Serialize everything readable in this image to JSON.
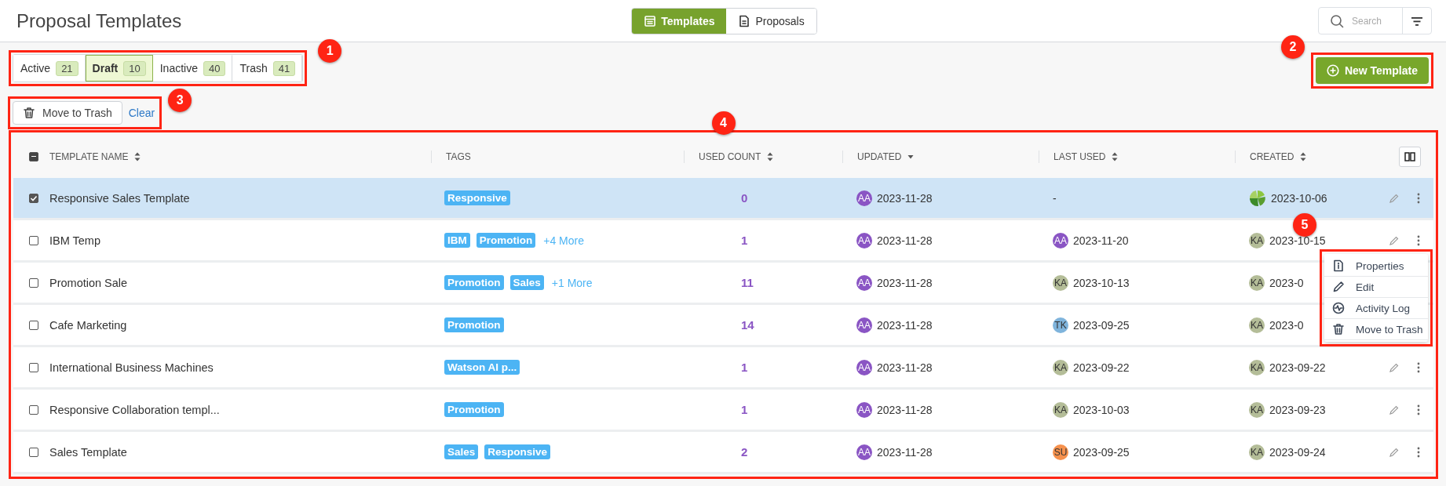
{
  "header": {
    "title": "Proposal Templates",
    "view_toggle": [
      {
        "kind": "templates",
        "label": "Templates",
        "selected": true
      },
      {
        "kind": "proposals",
        "label": "Proposals",
        "selected": false
      }
    ],
    "search": {
      "placeholder": "Search"
    }
  },
  "status_tabs": {
    "annotation": "1",
    "tabs": [
      {
        "label": "Active",
        "count": "21",
        "selected": false
      },
      {
        "label": "Draft",
        "count": "10",
        "selected": true
      },
      {
        "label": "Inactive",
        "count": "40",
        "selected": false
      },
      {
        "label": "Trash",
        "count": "41",
        "selected": false
      }
    ]
  },
  "new_button": {
    "label": "New Template",
    "annotation": "2"
  },
  "bulk_actions": {
    "annotation": "3",
    "move_button": "Move to Trash",
    "clear_link": "Clear"
  },
  "table": {
    "annotation": "4",
    "select_all_partial": true,
    "columns": [
      {
        "label": "TEMPLATE NAME",
        "sortable": true,
        "sorted_desc": false
      },
      {
        "label": "TAGS",
        "sortable": false,
        "sorted_desc": false
      },
      {
        "label": "USED COUNT",
        "sortable": true,
        "sorted_desc": false
      },
      {
        "label": "UPDATED",
        "sortable": true,
        "sorted_desc": true
      },
      {
        "label": "LAST USED",
        "sortable": true,
        "sorted_desc": false
      },
      {
        "label": "CREATED",
        "sortable": true,
        "sorted_desc": false
      }
    ],
    "rows": [
      {
        "selected": true,
        "name": "Responsive Sales Template",
        "tags": [
          "Responsive"
        ],
        "used_count": "0",
        "updated": {
          "avatar": {
            "kind": "initials",
            "initials": "AA",
            "color": "#8a55c4"
          },
          "date": "2023-11-28"
        },
        "last_used": {
          "date": "-"
        },
        "created": {
          "avatar": {
            "kind": "logo"
          },
          "date": "2023-10-06"
        },
        "actions_visible": true
      },
      {
        "selected": false,
        "name": "IBM Temp",
        "tags": [
          "IBM",
          "Promotion"
        ],
        "more": "+4 More",
        "used_count": "1",
        "updated": {
          "avatar": {
            "kind": "initials",
            "initials": "AA",
            "color": "#8a55c4"
          },
          "date": "2023-11-28"
        },
        "last_used": {
          "avatar": {
            "kind": "initials",
            "initials": "AA",
            "color": "#8a55c4"
          },
          "date": "2023-11-20"
        },
        "created": {
          "avatar": {
            "kind": "initials",
            "initials": "KA",
            "color": "#b4bd98"
          },
          "date": "2023-10-15"
        },
        "actions_visible": true
      },
      {
        "selected": false,
        "name": "Promotion Sale",
        "tags": [
          "Promotion",
          "Sales"
        ],
        "more": "+1 More",
        "used_count": "11",
        "updated": {
          "avatar": {
            "kind": "initials",
            "initials": "AA",
            "color": "#8a55c4"
          },
          "date": "2023-11-28"
        },
        "last_used": {
          "avatar": {
            "kind": "initials",
            "initials": "KA",
            "color": "#b4bd98"
          },
          "date": "2023-10-13"
        },
        "created": {
          "avatar": {
            "kind": "initials",
            "initials": "KA",
            "color": "#b4bd98"
          },
          "date": "2023-0"
        },
        "actions_visible": false
      },
      {
        "selected": false,
        "name": "Cafe Marketing",
        "tags": [
          "Promotion"
        ],
        "used_count": "14",
        "updated": {
          "avatar": {
            "kind": "initials",
            "initials": "AA",
            "color": "#8a55c4"
          },
          "date": "2023-11-28"
        },
        "last_used": {
          "avatar": {
            "kind": "initials",
            "initials": "TK",
            "color": "#7fb4dc"
          },
          "date": "2023-09-25"
        },
        "created": {
          "avatar": {
            "kind": "initials",
            "initials": "KA",
            "color": "#b4bd98"
          },
          "date": "2023-0"
        },
        "actions_visible": false
      },
      {
        "selected": false,
        "name": "International Business Machines",
        "tags": [
          "Watson AI p..."
        ],
        "used_count": "1",
        "updated": {
          "avatar": {
            "kind": "initials",
            "initials": "AA",
            "color": "#8a55c4"
          },
          "date": "2023-11-28"
        },
        "last_used": {
          "avatar": {
            "kind": "initials",
            "initials": "KA",
            "color": "#b4bd98"
          },
          "date": "2023-09-22"
        },
        "created": {
          "avatar": {
            "kind": "initials",
            "initials": "KA",
            "color": "#b4bd98"
          },
          "date": "2023-09-22"
        },
        "actions_visible": true
      },
      {
        "selected": false,
        "name": "Responsive Collaboration templ...",
        "tags": [
          "Promotion"
        ],
        "used_count": "1",
        "updated": {
          "avatar": {
            "kind": "initials",
            "initials": "AA",
            "color": "#8a55c4"
          },
          "date": "2023-11-28"
        },
        "last_used": {
          "avatar": {
            "kind": "initials",
            "initials": "KA",
            "color": "#b4bd98"
          },
          "date": "2023-10-03"
        },
        "created": {
          "avatar": {
            "kind": "initials",
            "initials": "KA",
            "color": "#b4bd98"
          },
          "date": "2023-09-23"
        },
        "actions_visible": true
      },
      {
        "selected": false,
        "name": "Sales Template",
        "tags": [
          "Sales",
          "Responsive"
        ],
        "used_count": "2",
        "updated": {
          "avatar": {
            "kind": "initials",
            "initials": "AA",
            "color": "#8a55c4"
          },
          "date": "2023-11-28"
        },
        "last_used": {
          "avatar": {
            "kind": "initials",
            "initials": "SU",
            "color": "#f6914d"
          },
          "date": "2023-09-25"
        },
        "created": {
          "avatar": {
            "kind": "initials",
            "initials": "KA",
            "color": "#b4bd98"
          },
          "date": "2023-09-24"
        },
        "actions_visible": true
      }
    ]
  },
  "row_menu": {
    "annotation": "5",
    "items": [
      {
        "kind": "properties",
        "label": "Properties"
      },
      {
        "kind": "edit",
        "label": "Edit"
      },
      {
        "kind": "activity",
        "label": "Activity Log"
      },
      {
        "kind": "trash",
        "label": "Move to Trash"
      }
    ]
  }
}
